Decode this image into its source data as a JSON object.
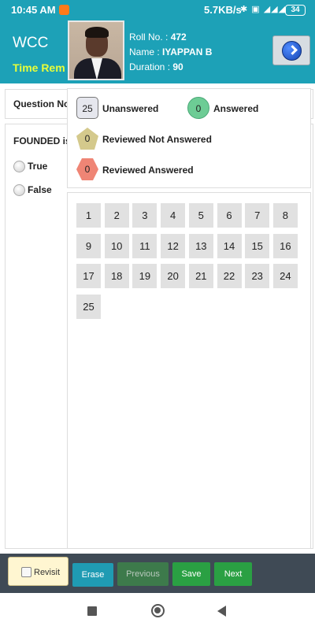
{
  "status_bar": {
    "time": "10:45 AM",
    "speed": "5.7KB/s",
    "indicators": "✱ ▣ ◢◢◢",
    "battery": "34"
  },
  "header": {
    "brand": "WCC",
    "time_remaining_label": "Time Rem",
    "roll_label": "Roll No. :",
    "roll_value": "472",
    "name_label": "Name :",
    "name_value": "IYAPPAN B",
    "duration_label": "Duration :",
    "duration_value": "90"
  },
  "question": {
    "number_label": "Question No",
    "text": "FOUNDED is",
    "options": [
      "True",
      "False"
    ]
  },
  "legend": {
    "unanswered": {
      "count": "25",
      "label": "Unanswered"
    },
    "answered": {
      "count": "0",
      "label": "Answered"
    },
    "reviewed_not_answered": {
      "count": "0",
      "label": "Reviewed Not Answered"
    },
    "reviewed_answered": {
      "count": "0",
      "label": "Reviewed Answered"
    }
  },
  "question_numbers": [
    "1",
    "2",
    "3",
    "4",
    "5",
    "6",
    "7",
    "8",
    "9",
    "10",
    "11",
    "12",
    "13",
    "14",
    "15",
    "16",
    "17",
    "18",
    "19",
    "20",
    "21",
    "22",
    "23",
    "24",
    "25"
  ],
  "toolbar": {
    "revisit": "Revisit",
    "erase": "Erase",
    "previous": "Previous",
    "save": "Save",
    "next": "Next"
  }
}
